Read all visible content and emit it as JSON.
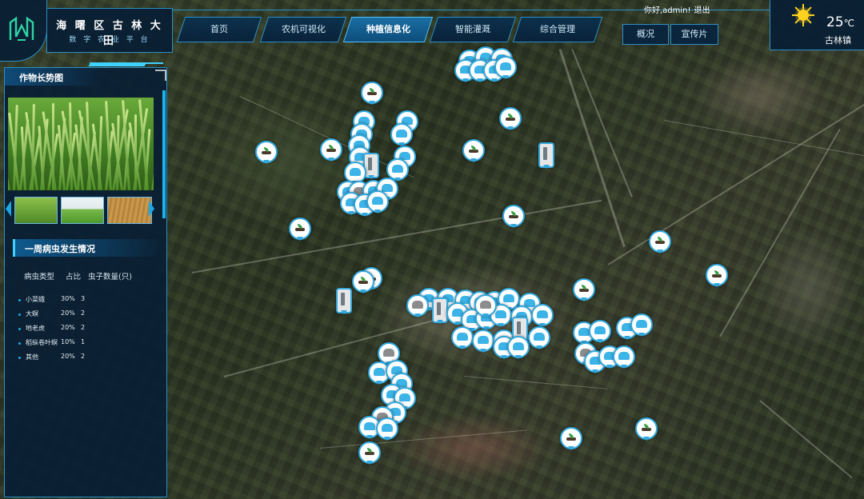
{
  "header": {
    "title": "海 曙 区 古 林 大 田",
    "subtitle": "数 字 农 业 平 台",
    "user_greeting": "你好,admin!",
    "logout_label": "退出"
  },
  "nav": {
    "tabs": [
      {
        "label": "首页",
        "active": false
      },
      {
        "label": "农机可视化",
        "active": false
      },
      {
        "label": "种植信息化",
        "active": true
      },
      {
        "label": "智能灌溉",
        "active": false
      },
      {
        "label": "综合管理",
        "active": false
      }
    ]
  },
  "right_tabs": [
    {
      "label": "概况"
    },
    {
      "label": "宣传片"
    }
  ],
  "weather": {
    "icon": "sun-icon",
    "temperature": "25",
    "unit": "℃",
    "location": "古林镇"
  },
  "left_panel": {
    "header": "作物长势图",
    "pest_section_title": "一周病虫发生情况",
    "table_headers": [
      "病虫类型",
      "占比",
      "虫子数量(只)"
    ],
    "table_rows": [
      {
        "type": "小菜蛾",
        "ratio": "30%",
        "count": "3"
      },
      {
        "type": "大螟",
        "ratio": "20%",
        "count": "2"
      },
      {
        "type": "地老虎",
        "ratio": "20%",
        "count": "2"
      },
      {
        "type": "稻纵卷叶螟",
        "ratio": "10%",
        "count": "1"
      },
      {
        "type": "其他",
        "ratio": "20%",
        "count": "2"
      }
    ]
  },
  "colors": {
    "accent": "#3fd1ff",
    "panel_bg": "#081e34",
    "border": "#2a8fc4",
    "active_tab": "#1a6ea3"
  },
  "map_markers": {
    "icon_types": [
      "pest-trap-icon",
      "plant-sensor-icon",
      "device-icon"
    ]
  }
}
